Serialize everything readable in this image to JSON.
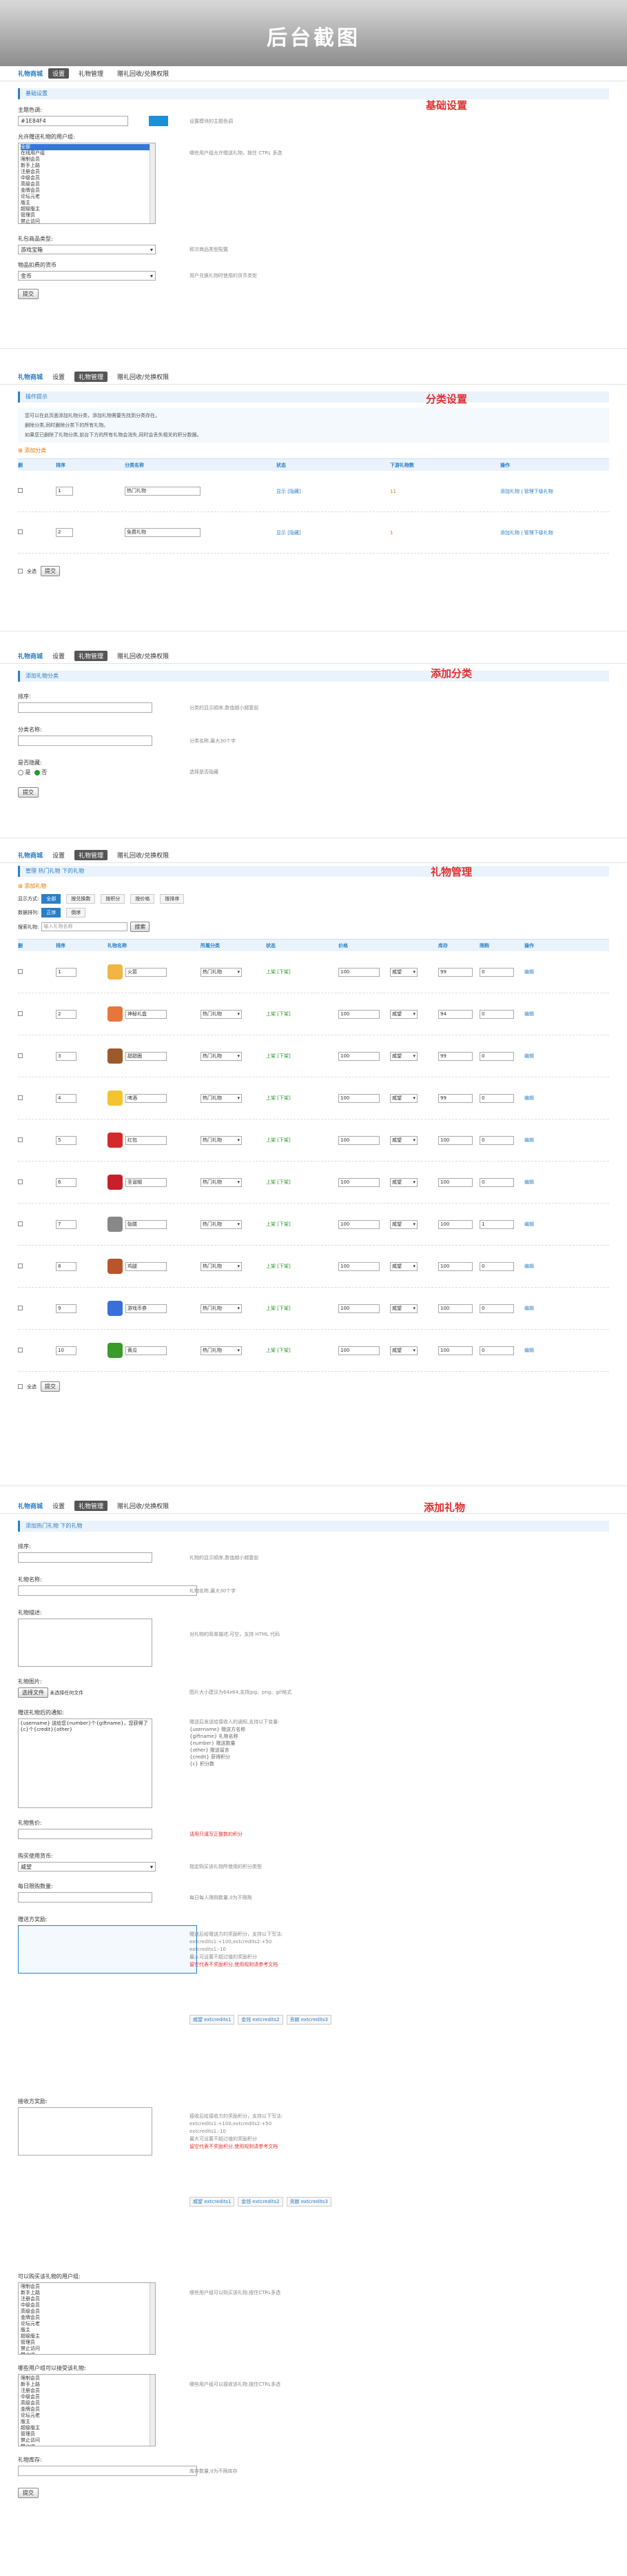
{
  "banner": {
    "title": "后台截图"
  },
  "s1": {
    "note": "基础设置",
    "nav": {
      "brand": "礼物商城",
      "tabs": [
        "设置",
        "礼物管理",
        "赠礼回收/兑换权限"
      ]
    },
    "subtitle": "基础设置",
    "fields": [
      {
        "label": "主题色调:",
        "value": "#1E84F4",
        "tip": "设置模块的主题色调"
      },
      {
        "label": "允许赠送礼物的用户组:",
        "tip": "哪些用户组允许赠送礼物，按住 CTRL 多选"
      },
      {
        "label": "礼包商品类型:",
        "value": "游戏宝箱",
        "tip": "即次商品类型配置"
      },
      {
        "label": "物品扣费的货币",
        "value": "金币",
        "tip": "用户兑换礼物时使用的货币类型"
      }
    ],
    "groups": [
      "全部",
      "在线用户组",
      "限制会员",
      "新手上路",
      "注册会员",
      "中级会员",
      "高级会员",
      "金牌会员",
      "论坛元老",
      "版主",
      "超级版主",
      "管理员",
      "禁止访问",
      "禁止发言",
      "禁止IP",
      "等待验证会员",
      "游客"
    ],
    "submit": "提交"
  },
  "s2": {
    "note": "分类设置",
    "nav": {
      "brand": "礼物商城",
      "tabs": [
        "设置",
        "礼物管理",
        "赠礼回收/兑换权限"
      ]
    },
    "subtitle": "操作提示",
    "tips": [
      "您可以在此页面添加礼物分类，添加礼物需要先找到分类存在。",
      "删除分类,同时删除分类下的所有礼物。",
      "如果您已删除了礼物分类,前台下方的所有礼物会消失,同时会丢失相关的积分数据。"
    ],
    "add": "添加分类",
    "headers": [
      "删",
      "排序",
      "分类名称",
      "状态",
      "下游礼物数",
      "操作"
    ],
    "rows": [
      {
        "order": "1",
        "name": "热门礼物",
        "status": "显示 [隐藏]",
        "count": "11",
        "ops": "添加礼物 | 管理下级礼物"
      },
      {
        "order": "2",
        "name": "免费礼物",
        "status": "显示 [隐藏]",
        "count": "1",
        "ops": "添加礼物 | 管理下级礼物"
      }
    ],
    "delall": "全选",
    "submit": "提交"
  },
  "s3": {
    "note": "添加分类",
    "nav": {
      "brand": "礼物商城",
      "tabs": [
        "设置",
        "礼物管理",
        "赠礼回收/兑换权限"
      ]
    },
    "subtitle": "添加礼物分类",
    "fields": [
      {
        "label": "排序:",
        "tip": "分类的显示顺序,数值越小越靠前"
      },
      {
        "label": "分类名称:",
        "tip": "分类名称,最大30个字"
      },
      {
        "label": "是否隐藏:",
        "tip": "选择是否隐藏"
      }
    ],
    "radio": [
      "是",
      "否"
    ],
    "submit": "提交"
  },
  "s4": {
    "note": "礼物管理",
    "nav": {
      "brand": "礼物商城",
      "tabs": [
        "设置",
        "礼物管理",
        "赠礼回收/兑换权限"
      ]
    },
    "crumb": "管理 热门礼物 下的礼物",
    "add": "添加礼物",
    "filter_label": "显示方式:",
    "filters": [
      "全部",
      "按兑换数",
      "按积分",
      "按价格",
      "按排序"
    ],
    "sort_label": "数据排列:",
    "sorts": [
      "正序",
      "倒序"
    ],
    "search_label": "搜索礼物:",
    "search_ph": "输入礼物名称",
    "search_btn": "搜索",
    "headers": [
      "删",
      "排序",
      "礼物名称",
      "所属分类",
      "状态",
      "价格",
      "",
      "库存",
      "限购",
      "操作"
    ],
    "rows": [
      {
        "order": "1",
        "name": "火箭",
        "cat": "热门礼物",
        "status": "上架 [下架]",
        "price": "100",
        "cur": "威望",
        "stock": "99",
        "limit": "0",
        "op": "编辑",
        "color": "#f2b544"
      },
      {
        "order": "2",
        "name": "神秘礼盒",
        "cat": "热门礼物",
        "status": "上架 [下架]",
        "price": "100",
        "cur": "威望",
        "stock": "94",
        "limit": "0",
        "op": "编辑",
        "color": "#e6763a"
      },
      {
        "order": "3",
        "name": "甜甜圈",
        "cat": "热门礼物",
        "status": "上架 [下架]",
        "price": "100",
        "cur": "威望",
        "stock": "99",
        "limit": "0",
        "op": "编辑",
        "color": "#9c5a2a"
      },
      {
        "order": "4",
        "name": "啤酒",
        "cat": "热门礼物",
        "status": "上架 [下架]",
        "price": "100",
        "cur": "威望",
        "stock": "99",
        "limit": "0",
        "op": "编辑",
        "color": "#f4c430"
      },
      {
        "order": "5",
        "name": "红包",
        "cat": "热门礼物",
        "status": "上架 [下架]",
        "price": "100",
        "cur": "威望",
        "stock": "100",
        "limit": "0",
        "op": "编辑",
        "color": "#d42a2a"
      },
      {
        "order": "6",
        "name": "圣诞帽",
        "cat": "热门礼物",
        "status": "上架 [下架]",
        "price": "100",
        "cur": "威望",
        "stock": "100",
        "limit": "0",
        "op": "编辑",
        "color": "#c8202a"
      },
      {
        "order": "7",
        "name": "骷髅",
        "cat": "热门礼物",
        "status": "上架 [下架]",
        "price": "100",
        "cur": "威望",
        "stock": "100",
        "limit": "1",
        "op": "编辑",
        "color": "#888888"
      },
      {
        "order": "8",
        "name": "鸡腿",
        "cat": "热门礼物",
        "status": "上架 [下架]",
        "price": "100",
        "cur": "威望",
        "stock": "100",
        "limit": "0",
        "op": "编辑",
        "color": "#b8552a"
      },
      {
        "order": "9",
        "name": "游戏币券",
        "cat": "热门礼物",
        "status": "上架 [下架]",
        "price": "100",
        "cur": "威望",
        "stock": "100",
        "limit": "0",
        "op": "编辑",
        "color": "#3a6fd8"
      },
      {
        "order": "10",
        "name": "黄瓜",
        "cat": "热门礼物",
        "status": "上架 [下架]",
        "price": "100",
        "cur": "威望",
        "stock": "100",
        "limit": "0",
        "op": "编辑",
        "color": "#3a9a2a"
      }
    ],
    "delall": "全选",
    "submit": "提交"
  },
  "s5": {
    "note": "添加礼物",
    "nav": {
      "brand": "礼物商城",
      "tabs": [
        "设置",
        "礼物管理",
        "赠礼回收/兑换权限"
      ]
    },
    "subtitle": "添加热门礼物 下的礼物",
    "f_order": {
      "label": "排序:",
      "tip": "礼物的显示顺序,数值越小越靠前"
    },
    "f_name": {
      "label": "礼物名称:",
      "tip": "礼物名称,最大30个字"
    },
    "f_desc": {
      "label": "礼物描述:",
      "tip": "对礼物的简单描述,可空，支持 HTML 代码"
    },
    "f_img": {
      "label": "礼物图片:",
      "btn": "选择文件",
      "file": "未选择任何文件",
      "tip": "图片大小建议为64x64,支持jpg、png、gif格式"
    },
    "f_tpl": {
      "label": "赠送礼物后的通知:",
      "value": "{username} 送给您{number}个{giftname}，您获得了{c}个{credit}{other}",
      "tip": "赠送后发送给接收人的通知,支持以下变量:",
      "vars": [
        "{username} 赠送方名称",
        "{giftname} 礼物名称",
        "{number} 赠送数量",
        "{other} 赠送留言",
        "{credit} 获得积分",
        "{c} 积分数"
      ]
    },
    "f_price": {
      "label": "礼物售价:",
      "tip": "请用只填写正整数的积分"
    },
    "f_cur": {
      "label": "购买使用货币:",
      "value": "威望",
      "tip": "指定购买该礼物所使用的积分类型"
    },
    "f_stock": {
      "label": "每日限购数量:",
      "tip": "每日每人限购数量,0为不限购"
    },
    "f_credit1": {
      "label": "赠送方奖励:",
      "tip": "赠送后给赠送方的奖励积分，支持以下写法:",
      "tips2": [
        "extcredits1:+100,extcredits2:+50",
        "extcredits1:-10",
        "最大可设置不超过值的奖励积分",
        "留空代表不奖励积分,使用规则请参考文档"
      ],
      "tags": [
        "威望 extcredits1",
        "金钱 extcredits2",
        "贡献 extcredits3"
      ]
    },
    "f_credit2": {
      "label": "接收方奖励:",
      "tip": "接收后给接收方的奖励积分，支持以下写法:",
      "tips2": [
        "extcredits1:+100,extcredits2:+50",
        "extcredits1:-10",
        "最大可设置不超过值的奖励积分",
        "留空代表不奖励积分,使用规则请参考文档"
      ],
      "tags": [
        "威望 extcredits1",
        "金钱 extcredits2",
        "贡献 extcredits3"
      ]
    },
    "f_buygroups": {
      "label": "可以购买该礼物的用户组:",
      "tip": "哪些用户组可以购买该礼物,按住CTRL多选"
    },
    "f_recvgroups": {
      "label": "哪些用户组可以接受该礼物:",
      "tip": "哪些用户组可以接收该礼物,按住CTRL多选"
    },
    "f_sort": {
      "label": "礼物库存:",
      "tip": "库存数量,0为不限库存"
    },
    "groups": [
      "限制会员",
      "新手上路",
      "注册会员",
      "中级会员",
      "高级会员",
      "金牌会员",
      "论坛元老",
      "版主",
      "超级版主",
      "管理员",
      "禁止访问",
      "禁止IP"
    ],
    "submit": "提交"
  }
}
